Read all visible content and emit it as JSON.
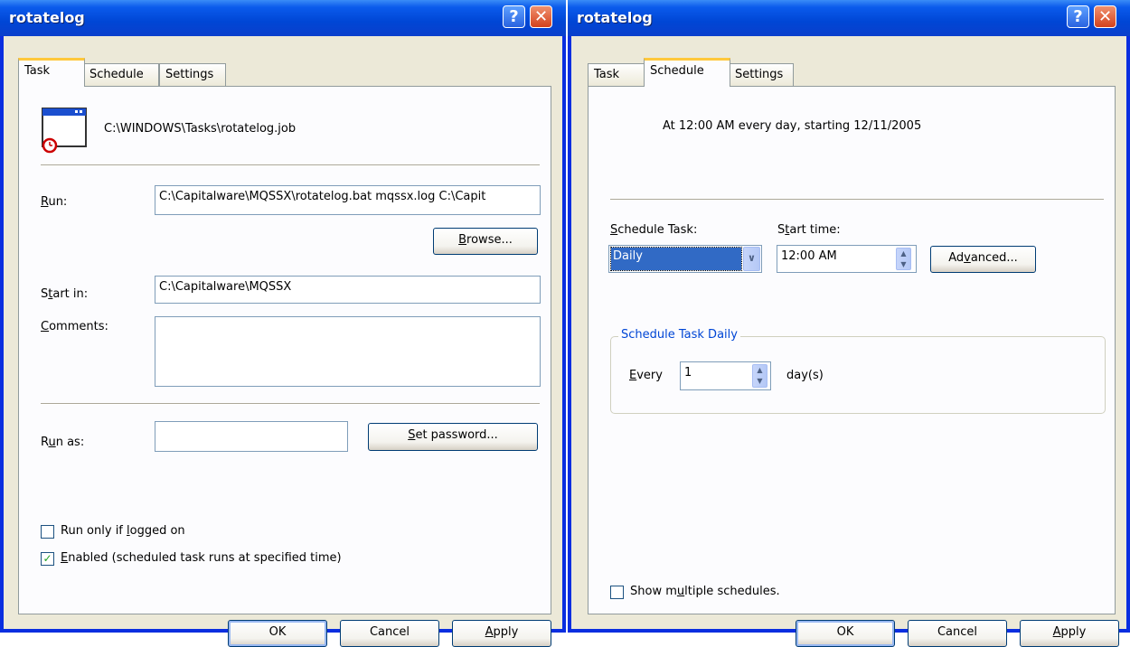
{
  "left_dialog": {
    "title": "rotatelog",
    "tabs": [
      "Task",
      "Schedule",
      "Settings"
    ],
    "active_tab": "Task",
    "job_path": "C:\\WINDOWS\\Tasks\\rotatelog.job",
    "run_label": {
      "pre": "",
      "acc": "R",
      "post": "un:"
    },
    "run_value": "C:\\Capitalware\\MQSSX\\rotatelog.bat mqssx.log C:\\Capit",
    "browse_button": {
      "pre": "",
      "acc": "B",
      "post": "rowse..."
    },
    "start_in_label": {
      "pre": "S",
      "acc": "t",
      "post": "art in:"
    },
    "start_in_value": "C:\\Capitalware\\MQSSX",
    "comments_label": {
      "pre": "",
      "acc": "C",
      "post": "omments:"
    },
    "comments_value": "",
    "run_as_label": {
      "pre": "R",
      "acc": "u",
      "post": "n as:"
    },
    "run_as_value": "",
    "set_password_button": {
      "pre": "",
      "acc": "S",
      "post": "et password..."
    },
    "run_only_logged_on": {
      "pre": "Run only if ",
      "acc": "l",
      "post": "ogged on",
      "checked": false
    },
    "enabled": {
      "pre": "",
      "acc": "E",
      "post": "nabled (scheduled task runs at specified time)",
      "checked": true
    },
    "ok": "OK",
    "cancel": "Cancel",
    "apply": {
      "pre": "",
      "acc": "A",
      "post": "pply"
    }
  },
  "right_dialog": {
    "title": "rotatelog",
    "tabs": [
      "Task",
      "Schedule",
      "Settings"
    ],
    "active_tab": "Schedule",
    "summary": "At 12:00 AM every day, starting 12/11/2005",
    "schedule_task_label": {
      "pre": "",
      "acc": "S",
      "post": "chedule Task:"
    },
    "schedule_task_value": "Daily",
    "start_time_label": {
      "pre": "S",
      "acc": "t",
      "post": "art time:"
    },
    "start_time_value": "12:00 AM",
    "advanced_button": {
      "pre": "Ad",
      "acc": "v",
      "post": "anced..."
    },
    "group_title": "Schedule Task Daily",
    "every_label": {
      "pre": "",
      "acc": "E",
      "post": "very"
    },
    "every_value": "1",
    "days_label": "day(s)",
    "show_multiple": {
      "pre": "Show m",
      "acc": "u",
      "post": "ltiple schedules.",
      "checked": false
    },
    "ok": "OK",
    "cancel": "Cancel",
    "apply": {
      "pre": "",
      "acc": "A",
      "post": "pply"
    }
  },
  "icons": {
    "help": "help-icon",
    "close": "close-icon",
    "task": "scheduled-task-icon",
    "check": "checkmark-icon"
  },
  "colors": {
    "titlebar": "#0046d5",
    "tab_highlight": "#ffc83c",
    "selection": "#316ac5",
    "group_title": "#0046d5",
    "check": "#21a121"
  }
}
